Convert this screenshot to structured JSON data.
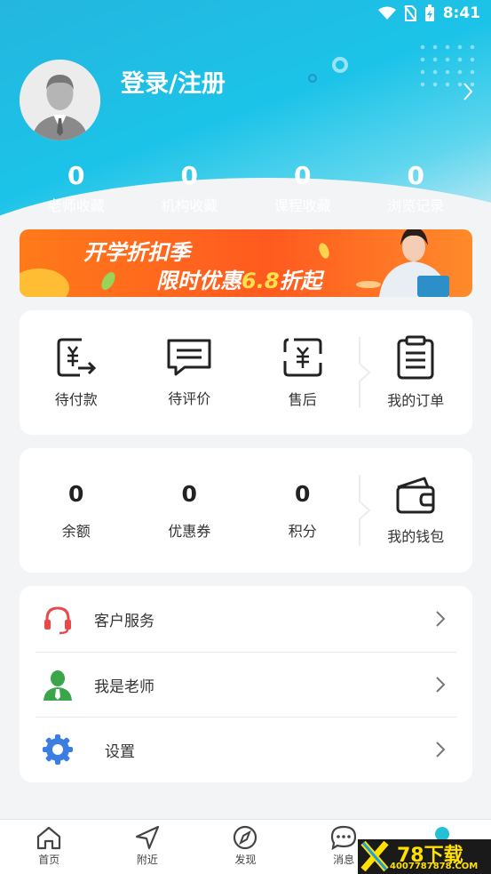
{
  "status_bar": {
    "time": "8:41"
  },
  "profile": {
    "login_label": "登录/注册"
  },
  "stats": [
    {
      "value": "0",
      "label": "老师收藏"
    },
    {
      "value": "0",
      "label": "机构收藏"
    },
    {
      "value": "0",
      "label": "课程收藏"
    },
    {
      "value": "0",
      "label": "浏览记录"
    }
  ],
  "banner": {
    "line1": "开学折扣季",
    "line2_prefix": "限时优惠",
    "line2_highlight": "6.8",
    "line2_suffix": "折起"
  },
  "orders": {
    "items": [
      {
        "label": "待付款",
        "icon": "payment-pending-icon"
      },
      {
        "label": "待评价",
        "icon": "review-pending-icon"
      },
      {
        "label": "售后",
        "icon": "after-sales-icon"
      }
    ],
    "summary_label": "我的订单"
  },
  "wallet": {
    "items": [
      {
        "value": "0",
        "label": "余额"
      },
      {
        "value": "0",
        "label": "优惠券"
      },
      {
        "value": "0",
        "label": "积分"
      }
    ],
    "summary_label": "我的钱包"
  },
  "menu": [
    {
      "label": "客户服务",
      "icon": "headset-icon"
    },
    {
      "label": "我是老师",
      "icon": "teacher-icon"
    },
    {
      "label": "设置",
      "icon": "gear-icon"
    }
  ],
  "bottom_nav": [
    {
      "label": "首页",
      "icon": "home-icon"
    },
    {
      "label": "附近",
      "icon": "navigation-icon"
    },
    {
      "label": "发现",
      "icon": "compass-icon"
    },
    {
      "label": "消息",
      "icon": "chat-icon"
    },
    {
      "label": "",
      "icon": "profile-icon"
    }
  ],
  "watermark": {
    "big": "78下载",
    "small": "4007787878.COM"
  },
  "colors": {
    "header": "#1cc3e8",
    "banner": "#ff5a1f",
    "headset": "#e84a4a",
    "teacher": "#3aa54a",
    "gear": "#3b7de0"
  }
}
